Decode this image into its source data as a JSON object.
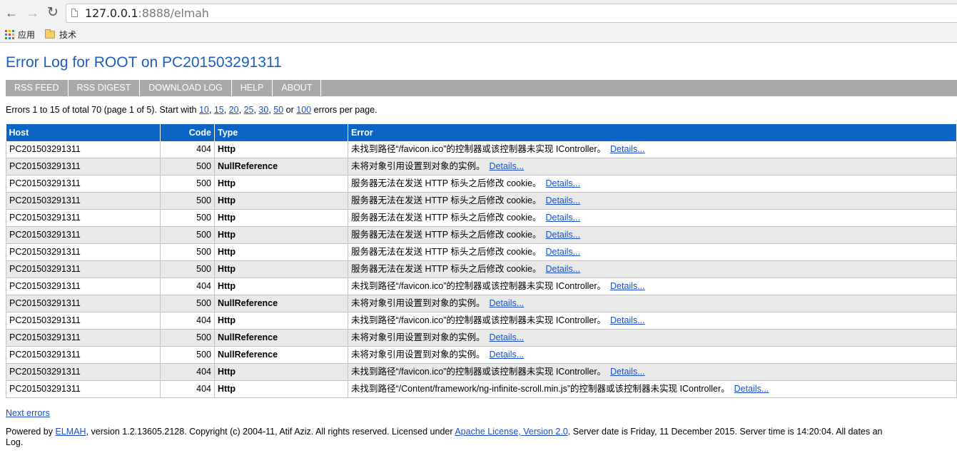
{
  "browser": {
    "url_host": "127.0.0.1",
    "url_rest": ":8888/elmah",
    "bookmarks": [
      "应用",
      "技术"
    ]
  },
  "page": {
    "title": "Error Log for ROOT on PC201503291311",
    "speedbar": [
      "RSS FEED",
      "RSS DIGEST",
      "DOWNLOAD LOG",
      "HELP",
      "ABOUT"
    ],
    "summary": {
      "prefix": "Errors 1 to 15 of total 70 (page 1 of 5). Start with",
      "sizes": [
        "10",
        "15",
        "20",
        "25",
        "30",
        "50"
      ],
      "or": "or",
      "last_size": "100",
      "suffix": "errors per page."
    },
    "table": {
      "headers": {
        "host": "Host",
        "code": "Code",
        "type": "Type",
        "error": "Error"
      },
      "details_label": "Details...",
      "rows": [
        {
          "host": "PC201503291311",
          "code": "404",
          "type": "Http",
          "error": "未找到路径“/favicon.ico”的控制器或该控制器未实现 IController。"
        },
        {
          "host": "PC201503291311",
          "code": "500",
          "type": "NullReference",
          "error": "未将对象引用设置到对象的实例。"
        },
        {
          "host": "PC201503291311",
          "code": "500",
          "type": "Http",
          "error": "服务器无法在发送 HTTP 标头之后修改 cookie。"
        },
        {
          "host": "PC201503291311",
          "code": "500",
          "type": "Http",
          "error": "服务器无法在发送 HTTP 标头之后修改 cookie。"
        },
        {
          "host": "PC201503291311",
          "code": "500",
          "type": "Http",
          "error": "服务器无法在发送 HTTP 标头之后修改 cookie。"
        },
        {
          "host": "PC201503291311",
          "code": "500",
          "type": "Http",
          "error": "服务器无法在发送 HTTP 标头之后修改 cookie。"
        },
        {
          "host": "PC201503291311",
          "code": "500",
          "type": "Http",
          "error": "服务器无法在发送 HTTP 标头之后修改 cookie。"
        },
        {
          "host": "PC201503291311",
          "code": "500",
          "type": "Http",
          "error": "服务器无法在发送 HTTP 标头之后修改 cookie。"
        },
        {
          "host": "PC201503291311",
          "code": "404",
          "type": "Http",
          "error": "未找到路径“/favicon.ico”的控制器或该控制器未实现 IController。"
        },
        {
          "host": "PC201503291311",
          "code": "500",
          "type": "NullReference",
          "error": "未将对象引用设置到对象的实例。"
        },
        {
          "host": "PC201503291311",
          "code": "404",
          "type": "Http",
          "error": "未找到路径“/favicon.ico”的控制器或该控制器未实现 IController。"
        },
        {
          "host": "PC201503291311",
          "code": "500",
          "type": "NullReference",
          "error": "未将对象引用设置到对象的实例。"
        },
        {
          "host": "PC201503291311",
          "code": "500",
          "type": "NullReference",
          "error": "未将对象引用设置到对象的实例。"
        },
        {
          "host": "PC201503291311",
          "code": "404",
          "type": "Http",
          "error": "未找到路径“/favicon.ico”的控制器或该控制器未实现 IController。"
        },
        {
          "host": "PC201503291311",
          "code": "404",
          "type": "Http",
          "error": "未找到路径“/Content/framework/ng-infinite-scroll.min.js”的控制器或该控制器未实现 IController。"
        }
      ]
    },
    "next_errors": "Next errors",
    "footer": {
      "powered_by": "Powered by",
      "elmah": "ELMAH",
      "version_text": ", version 1.2.13605.2128. Copyright (c) 2004-11, Atif Aziz. All rights reserved. Licensed under",
      "license": "Apache License, Version 2.0",
      "server_text": ". Server date is Friday, 11 December 2015. Server time is 14:20:04. All dates an",
      "line2": "Log."
    }
  }
}
